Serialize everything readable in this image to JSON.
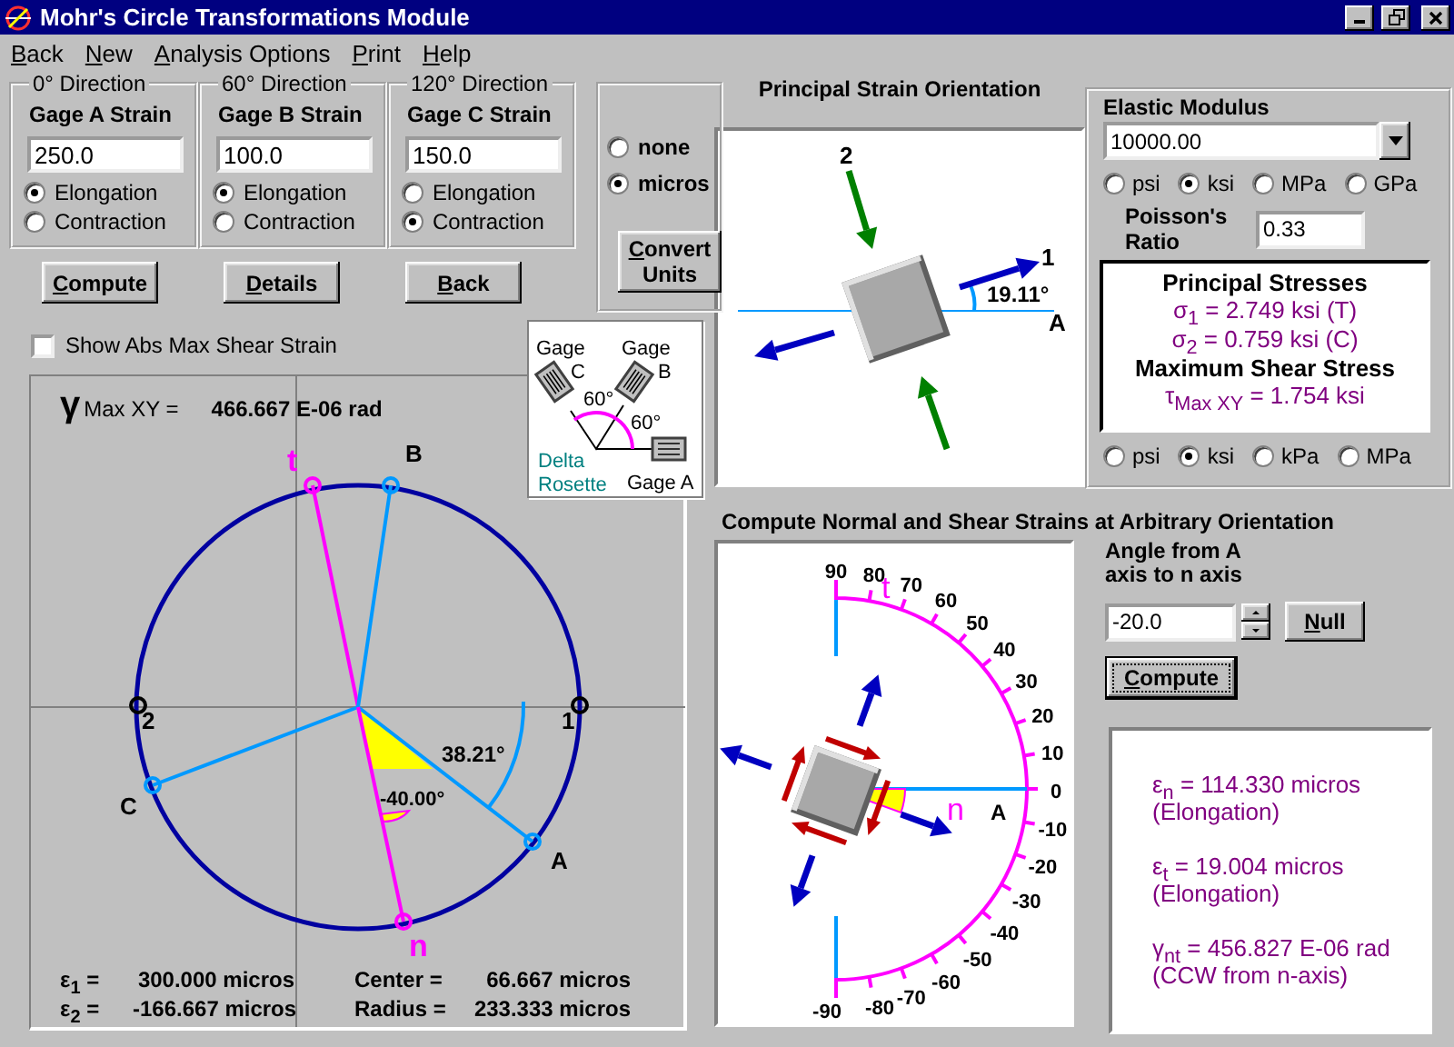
{
  "window": {
    "title": "Mohr's Circle Transformations Module"
  },
  "menu": [
    "Back",
    "New",
    "Analysis Options",
    "Print",
    "Help"
  ],
  "gages": [
    {
      "direction": "0° Direction",
      "label": "Gage A Strain",
      "value": "250.0",
      "options": [
        {
          "label": "Elongation",
          "selected": true
        },
        {
          "label": "Contraction",
          "selected": false
        }
      ]
    },
    {
      "direction": "60° Direction",
      "label": "Gage B Strain",
      "value": "100.0",
      "options": [
        {
          "label": "Elongation",
          "selected": true
        },
        {
          "label": "Contraction",
          "selected": false
        }
      ]
    },
    {
      "direction": "120° Direction",
      "label": "Gage C Strain",
      "value": "150.0",
      "options": [
        {
          "label": "Elongation",
          "selected": false
        },
        {
          "label": "Contraction",
          "selected": true
        }
      ]
    }
  ],
  "strain_units": {
    "options": [
      {
        "label": "none",
        "selected": false
      },
      {
        "label": "micros",
        "selected": true
      }
    ],
    "button": "Convert Units"
  },
  "buttons": [
    "Compute",
    "Details",
    "Back"
  ],
  "abs_max_shear": {
    "label": "Show Abs Max Shear Strain",
    "checked": false
  },
  "rosette": {
    "gage_c": [
      "Gage",
      "C"
    ],
    "gage_b": [
      "Gage",
      "B"
    ],
    "angles": [
      "60°",
      "60°"
    ],
    "title": [
      "Delta",
      "Rosette"
    ],
    "gage_a": "Gage A"
  },
  "mohr": {
    "gamma_symbol": "γ",
    "gamma_label": "Max XY =",
    "gamma_value": "466.667 E-06 rad",
    "points": [
      {
        "label": "t",
        "kind": "plane"
      },
      {
        "label": "B",
        "kind": "gage"
      },
      {
        "label": "C",
        "kind": "gage"
      },
      {
        "label": "A",
        "kind": "gage"
      },
      {
        "label": "n",
        "kind": "plane"
      },
      {
        "label": "1",
        "kind": "principal"
      },
      {
        "label": "2",
        "kind": "principal"
      }
    ],
    "angle_labels": [
      "38.21°",
      "-40.00°"
    ],
    "stats": [
      {
        "label": "ε$_{1}$ =",
        "value": "300.000 micros"
      },
      {
        "label": "Center =",
        "value": "66.667 micros"
      },
      {
        "label": "ε$_{2}$ =",
        "value": "-166.667 micros"
      },
      {
        "label": "Radius =",
        "value": "233.333 micros"
      }
    ]
  },
  "orientation": {
    "title": "Principal Strain Orientation",
    "labels": [
      "2",
      "1",
      "A"
    ],
    "angle": "19.11°"
  },
  "modulus": {
    "label": "Elastic Modulus",
    "value": "10000.00",
    "units": [
      {
        "label": "psi",
        "selected": false
      },
      {
        "label": "ksi",
        "selected": true
      },
      {
        "label": "MPa",
        "selected": false
      },
      {
        "label": "GPa",
        "selected": false
      }
    ],
    "poisson_label": "Poisson's Ratio",
    "poisson_value": "0.33",
    "stresses": [
      {
        "kind": "heading",
        "text": "Principal Stresses"
      },
      {
        "kind": "value",
        "text": "σ$_{1}$ = 2.749 ksi (T)"
      },
      {
        "kind": "value",
        "text": "σ$_{2}$ = 0.759 ksi (C)"
      },
      {
        "kind": "heading",
        "text": "Maximum Shear Stress"
      },
      {
        "kind": "value",
        "text": "τ$_{Max XY}$ = 1.754 ksi"
      }
    ],
    "stress_units": [
      {
        "label": "psi",
        "selected": false
      },
      {
        "label": "ksi",
        "selected": true
      },
      {
        "label": "kPa",
        "selected": false
      },
      {
        "label": "MPa",
        "selected": false
      }
    ]
  },
  "arbitrary": {
    "title": "Compute Normal and Shear Strains at Arbitrary Orientation",
    "ticks": [
      "90",
      "80",
      "70",
      "60",
      "50",
      "40",
      "30",
      "20",
      "10",
      "0",
      "-10",
      "-20",
      "-30",
      "-40",
      "-50",
      "-60",
      "-70",
      "-80",
      "-90"
    ],
    "axis_label": "A",
    "t_label": "t",
    "n_label": "n",
    "angle_label": "Angle from A axis to n axis",
    "angle_value": "-20.0",
    "null_button": "Null",
    "compute_button": "Compute",
    "results": [
      {
        "value": "ε$_{n}$ = 114.330 micros",
        "note": "(Elongation)"
      },
      {
        "value": "ε$_{t}$ = 19.004 micros",
        "note": "(Elongation)"
      },
      {
        "value": "γ$_{nt}$ = 456.827 E-06 rad",
        "note": "(CCW from n-axis)"
      }
    ]
  }
}
